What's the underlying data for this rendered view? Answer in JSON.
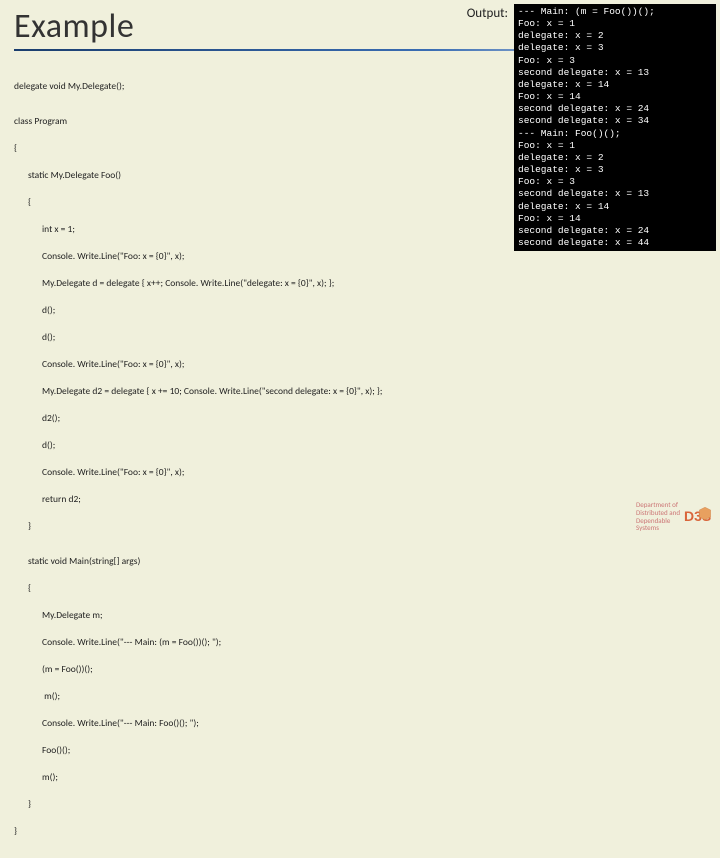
{
  "title": "Example",
  "output_label": "Output:",
  "code": {
    "l1": "delegate void My.Delegate();",
    "l2": "class Program",
    "l3": "{",
    "l4": "static My.Delegate Foo()",
    "l5": "{",
    "l6": "int x = 1;",
    "l7": "Console. Write.Line(\"Foo: x = {0}\", x);",
    "l8": "My.Delegate d = delegate { x++; Console. Write.Line(\"delegate: x = {0}\", x); };",
    "l9": "d();",
    "l10": "d();",
    "l11": "Console. Write.Line(\"Foo: x = {0}\", x);",
    "l12": "My.Delegate d2 = delegate { x += 10; Console. Write.Line(\"second delegate: x = {0}\", x); };",
    "l13": "d2();",
    "l14": "d();",
    "l15": "Console. Write.Line(\"Foo: x = {0}\", x);",
    "l16": "return d2;",
    "l17": "}",
    "m1": "static void Main(string[] args)",
    "m2": "{",
    "m3": "My.Delegate m;",
    "m4": "Console. Write.Line(\"--- Main: (m = Foo())(); \");",
    "m5": "(m = Foo())();",
    "m6": " m();",
    "m7": "Console. Write.Line(\"--- Main: Foo()(); \");",
    "m8": "Foo()();",
    "m9": "m();",
    "m10": "}",
    "end": "}"
  },
  "output": "--- Main: (m = Foo())();\nFoo: x = 1\ndelegate: x = 2\ndelegate: x = 3\nFoo: x = 3\nsecond delegate: x = 13\ndelegate: x = 14\nFoo: x = 14\nsecond delegate: x = 24\nsecond delegate: x = 34\n--- Main: Foo()();\nFoo: x = 1\ndelegate: x = 2\ndelegate: x = 3\nFoo: x = 3\nsecond delegate: x = 13\ndelegate: x = 14\nFoo: x = 14\nsecond delegate: x = 24\nsecond delegate: x = 44",
  "footer": {
    "l1": "Department of",
    "l2": "Distributed and",
    "l3": "Dependable",
    "l4": "Systems"
  },
  "logo_text": "D3S"
}
